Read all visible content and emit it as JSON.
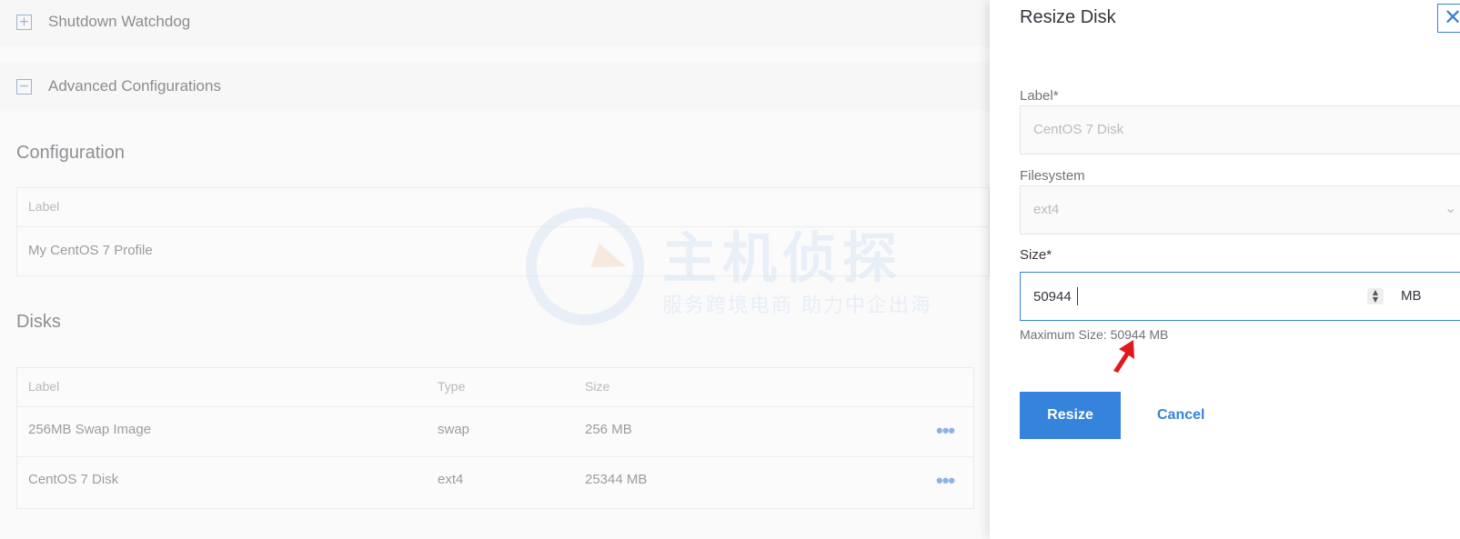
{
  "background": {
    "sections": [
      {
        "toggle": "+",
        "title": "Shutdown Watchdog"
      },
      {
        "toggle": "−",
        "title": "Advanced Configurations"
      }
    ],
    "configuration": {
      "heading": "Configuration",
      "label_header": "Label",
      "label_value": "My CentOS 7 Profile"
    },
    "disks": {
      "heading": "Disks",
      "columns": [
        "Label",
        "Type",
        "Size"
      ],
      "rows": [
        {
          "label": "256MB Swap Image",
          "type": "swap",
          "size": "256 MB",
          "actions": "•••"
        },
        {
          "label": "CentOS 7 Disk",
          "type": "ext4",
          "size": "25344 MB",
          "actions": "•••"
        }
      ]
    },
    "watermark": {
      "main": "主机侦探",
      "sub": "服务跨境电商 助力中企出海"
    }
  },
  "drawer": {
    "title": "Resize Disk",
    "close_icon": "close-icon",
    "label_field": {
      "label": "Label",
      "required": "*",
      "value": "CentOS 7 Disk"
    },
    "filesystem_field": {
      "label": "Filesystem",
      "value": "ext4",
      "chevron": "⌄"
    },
    "size_field": {
      "label": "Size",
      "required": "*",
      "value": "50944",
      "unit": "MB",
      "spinner": "▲\n▼"
    },
    "helper_text": "Maximum Size: 50944 MB",
    "resize_label": "Resize",
    "cancel_label": "Cancel"
  },
  "colors": {
    "accent": "#3683dc",
    "annotation_arrow": "#e0191b"
  }
}
